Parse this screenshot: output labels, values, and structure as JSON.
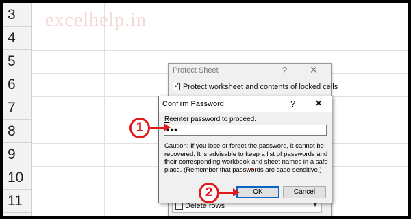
{
  "spreadsheet": {
    "row_numbers": [
      "3",
      "4",
      "5",
      "6",
      "7",
      "8",
      "9",
      "10",
      "11"
    ],
    "watermark": "excelhelp.in"
  },
  "protect_sheet": {
    "title": "Protect Sheet",
    "help": "?",
    "close": "✕",
    "protect_option_label": "Protect worksheet and contents of locked cells",
    "protect_option_checked": true,
    "list_item_label": "Delete rows",
    "list_item_checked": false
  },
  "confirm_password": {
    "title": "Confirm Password",
    "help": "?",
    "close": "✕",
    "prompt": "Reenter password to proceed.",
    "prompt_access_key": "R",
    "prompt_rest": "eenter password to proceed.",
    "password_value": "•••",
    "caution_text": "Caution: If you lose or forget the password, it cannot be recovered. It is advisable to keep a list of passwords and their corresponding workbook and sheet names in a safe place.  (Remember that passwords are case-sensitive.)",
    "ok_label": "OK",
    "cancel_label": "Cancel"
  },
  "annotations": {
    "step_1": "1",
    "step_2": "2",
    "color": "#e11b1b"
  }
}
